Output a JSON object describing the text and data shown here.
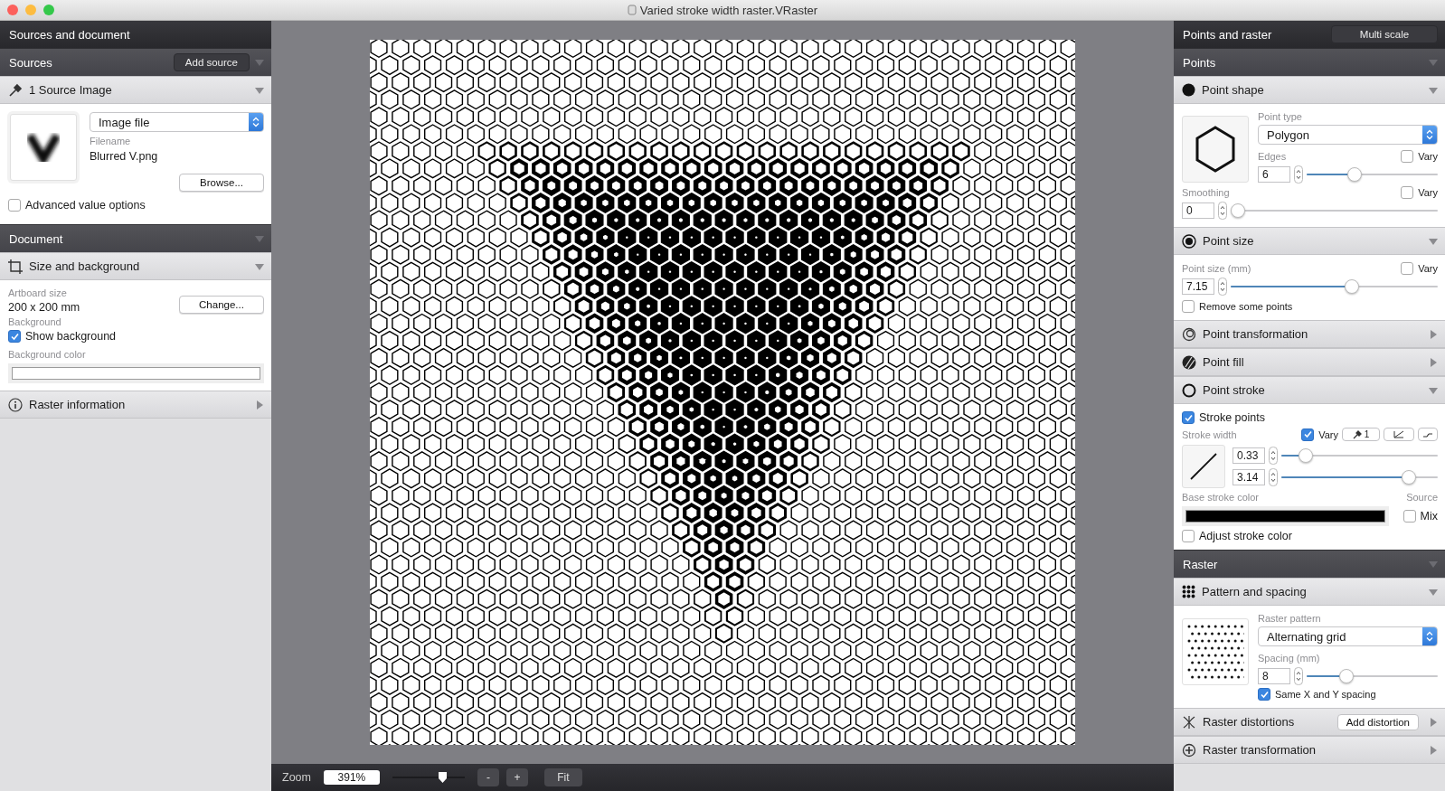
{
  "window": {
    "title": "Varied stroke width raster.VRaster"
  },
  "left_panel": {
    "title": "Sources and document",
    "groups": [
      {
        "title": "Sources",
        "expanded": true,
        "button": "Add source",
        "sections": [
          {
            "kind": "source_image",
            "title": "1 Source Image",
            "expanded": true,
            "source_type": "Image file",
            "filename_label": "Filename",
            "filename": "Blurred V.png",
            "browse_button": "Browse...",
            "advanced_value_options": {
              "label": "Advanced value options",
              "checked": false
            }
          }
        ]
      },
      {
        "title": "Document",
        "expanded": true,
        "sections": [
          {
            "kind": "size_and_background",
            "title": "Size and background",
            "expanded": true,
            "artboard_size_label": "Artboard size",
            "artboard_size": "200 x 200 mm",
            "change_button": "Change...",
            "background_label": "Background",
            "show_background": {
              "label": "Show background",
              "checked": true
            },
            "background_color_label": "Background color"
          },
          {
            "kind": "raster_information",
            "title": "Raster information",
            "expanded": false
          }
        ]
      }
    ]
  },
  "right_panel": {
    "title": "Points and raster",
    "multi_scale_button": "Multi scale",
    "groups": [
      {
        "title": "Points",
        "expanded": true,
        "sections": [
          {
            "kind": "point_shape",
            "title": "Point shape",
            "expanded": true,
            "point_type_label": "Point type",
            "point_type": "Polygon",
            "edges": {
              "label": "Edges",
              "value": "6",
              "level": 0.35,
              "vary": {
                "label": "Vary",
                "checked": false
              }
            },
            "smoothing": {
              "label": "Smoothing",
              "value": "0",
              "level": 0,
              "vary": {
                "label": "Vary",
                "checked": false
              }
            }
          },
          {
            "kind": "point_size",
            "title": "Point size",
            "expanded": true,
            "point_size": {
              "label": "Point size (mm)",
              "value": "7.15",
              "level": 0.59,
              "vary": {
                "label": "Vary",
                "checked": false
              }
            },
            "remove_some_points": {
              "label": "Remove some points",
              "checked": false
            }
          },
          {
            "kind": "point_transformation",
            "title": "Point transformation",
            "expanded": false
          },
          {
            "kind": "point_fill",
            "title": "Point fill",
            "expanded": false
          },
          {
            "kind": "point_stroke",
            "title": "Point stroke",
            "expanded": true,
            "stroke_points": {
              "label": "Stroke points",
              "checked": true
            },
            "stroke_width_label": "Stroke width",
            "vary": {
              "label": "Vary",
              "checked": true
            },
            "source_button": "1",
            "min": {
              "value": "0.33",
              "level": 0.12
            },
            "max": {
              "value": "3.14",
              "level": 0.85
            },
            "base_stroke_color_label": "Base stroke color",
            "source_label": "Source",
            "mix": {
              "label": "Mix",
              "checked": false
            },
            "adjust_stroke_color": {
              "label": "Adjust stroke color",
              "checked": false
            }
          }
        ]
      },
      {
        "title": "Raster",
        "expanded": true,
        "sections": [
          {
            "kind": "pattern_and_spacing",
            "title": "Pattern and spacing",
            "expanded": true,
            "raster_pattern_label": "Raster pattern",
            "raster_pattern": "Alternating grid",
            "spacing": {
              "label": "Spacing (mm)",
              "value": "8",
              "level": 0.28
            },
            "same_spacing": {
              "label": "Same X and Y spacing",
              "checked": true
            }
          },
          {
            "kind": "raster_distortions",
            "title": "Raster distortions",
            "expanded": false,
            "button": "Add distortion"
          },
          {
            "kind": "raster_transformation",
            "title": "Raster transformation",
            "expanded": false
          }
        ]
      }
    ]
  },
  "zoom_bar": {
    "label": "Zoom",
    "value": "391%",
    "level": 0.72,
    "buttons": [
      "-",
      "+",
      "Fit"
    ]
  }
}
